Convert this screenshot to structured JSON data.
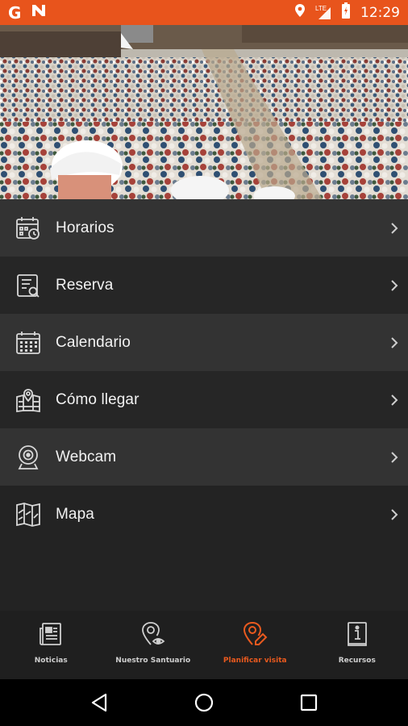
{
  "status_bar": {
    "time": "12:29",
    "lte_label": "LTE",
    "left_icons": [
      "google-icon",
      "news-icon"
    ],
    "right_icons": [
      "location-icon",
      "signal-icon",
      "battery-icon"
    ]
  },
  "hero": {
    "icon": "crowd-photo"
  },
  "menu": {
    "items": [
      {
        "label": "Horarios",
        "icon": "schedule-icon"
      },
      {
        "label": "Reserva",
        "icon": "reservation-icon"
      },
      {
        "label": "Calendario",
        "icon": "calendar-icon"
      },
      {
        "label": "Cómo llegar",
        "icon": "directions-map-icon"
      },
      {
        "label": "Webcam",
        "icon": "webcam-icon"
      },
      {
        "label": "Mapa",
        "icon": "map-icon"
      }
    ]
  },
  "tabs": {
    "items": [
      {
        "label": "Noticias",
        "icon": "newspaper-icon",
        "active": false
      },
      {
        "label": "Nuestro Santuario",
        "icon": "location-eye-icon",
        "active": false
      },
      {
        "label": "Planificar visita",
        "icon": "location-edit-icon",
        "active": true
      },
      {
        "label": "Recursos",
        "icon": "info-book-icon",
        "active": false
      }
    ]
  },
  "colors": {
    "accent": "#e8541c",
    "menu_light": "#333333",
    "menu_dark": "#262626",
    "background": "#232323"
  }
}
